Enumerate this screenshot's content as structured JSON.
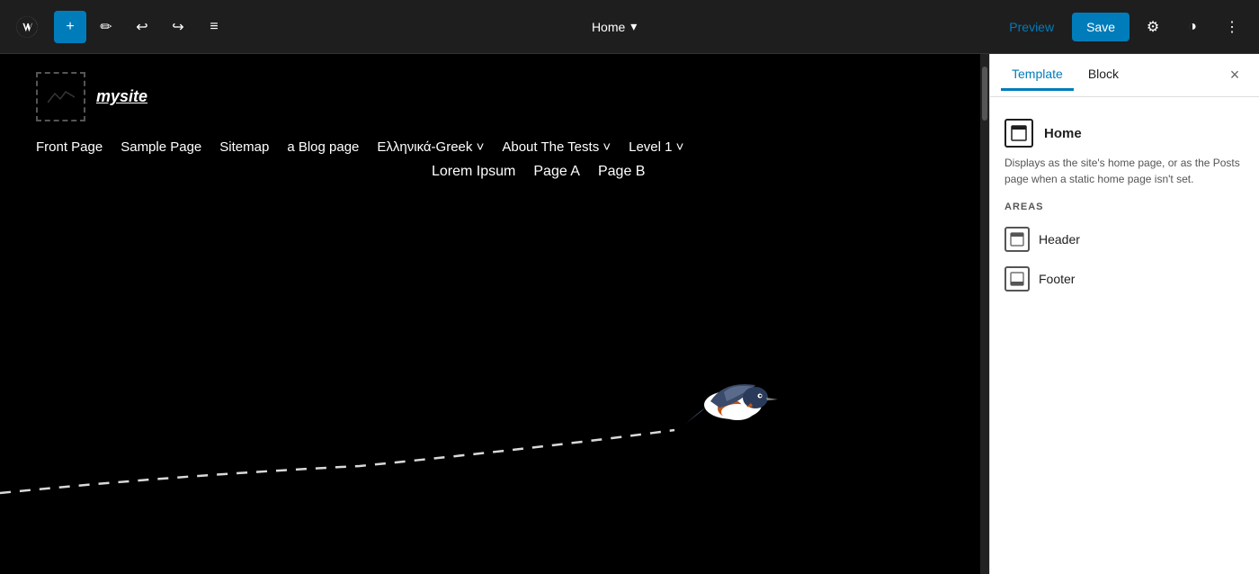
{
  "toolbar": {
    "add_label": "+",
    "pencil_label": "✏",
    "undo_label": "↩",
    "redo_label": "↪",
    "menu_label": "≡",
    "page_title": "Home",
    "page_chevron": "▾",
    "preview_label": "Preview",
    "save_label": "Save",
    "settings_label": "⚙",
    "contrast_label": "◑",
    "more_label": "⋮"
  },
  "site": {
    "name": "mysite",
    "nav_primary": [
      "Front Page",
      "Sample Page",
      "Sitemap",
      "a Blog page",
      "Ελληνικά-Greek ˅",
      "About The Tests ˅",
      "Level 1 ˅"
    ],
    "nav_secondary": [
      "Lorem Ipsum",
      "Page A",
      "Page B"
    ]
  },
  "panel": {
    "template_tab": "Template",
    "block_tab": "Block",
    "close_label": "×",
    "item_title": "Home",
    "item_description": "Displays as the site's home page, or as the Posts page when a static home page isn't set.",
    "areas_label": "AREAS",
    "areas": [
      {
        "label": "Header"
      },
      {
        "label": "Footer"
      }
    ]
  }
}
